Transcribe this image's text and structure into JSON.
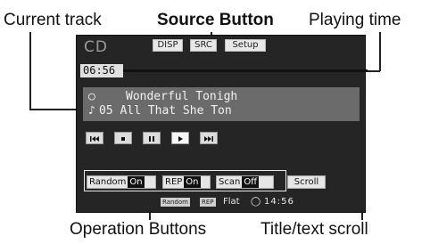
{
  "callouts": {
    "current_track": "Current track",
    "source_button": "Source Button",
    "playing_time": "Playing time",
    "operation_buttons": "Operation Buttons",
    "title_text_scroll": "Title/text scroll"
  },
  "screen": {
    "source_label": "CD",
    "top_buttons": {
      "disp": "DISP",
      "src": "SRC",
      "setup": "Setup"
    },
    "elapsed_time": "06:56",
    "progress_fraction": 0.0,
    "track_title": "Wonderful Tonigh",
    "track_line": "05 All That She Ton",
    "transport": [
      "previous-track-icon",
      "stop-icon",
      "pause-icon",
      "play-icon",
      "next-track-icon"
    ],
    "operations": {
      "random": {
        "label": "Random",
        "state": "On"
      },
      "rep": {
        "label": "REP",
        "state": "On"
      },
      "scan": {
        "label": "Scan",
        "state": "Off"
      }
    },
    "scroll_label": "Scroll",
    "status_bar": {
      "random_badge": "Random",
      "rep_badge": "REP",
      "eq": "Flat",
      "clock": "14:56"
    }
  }
}
